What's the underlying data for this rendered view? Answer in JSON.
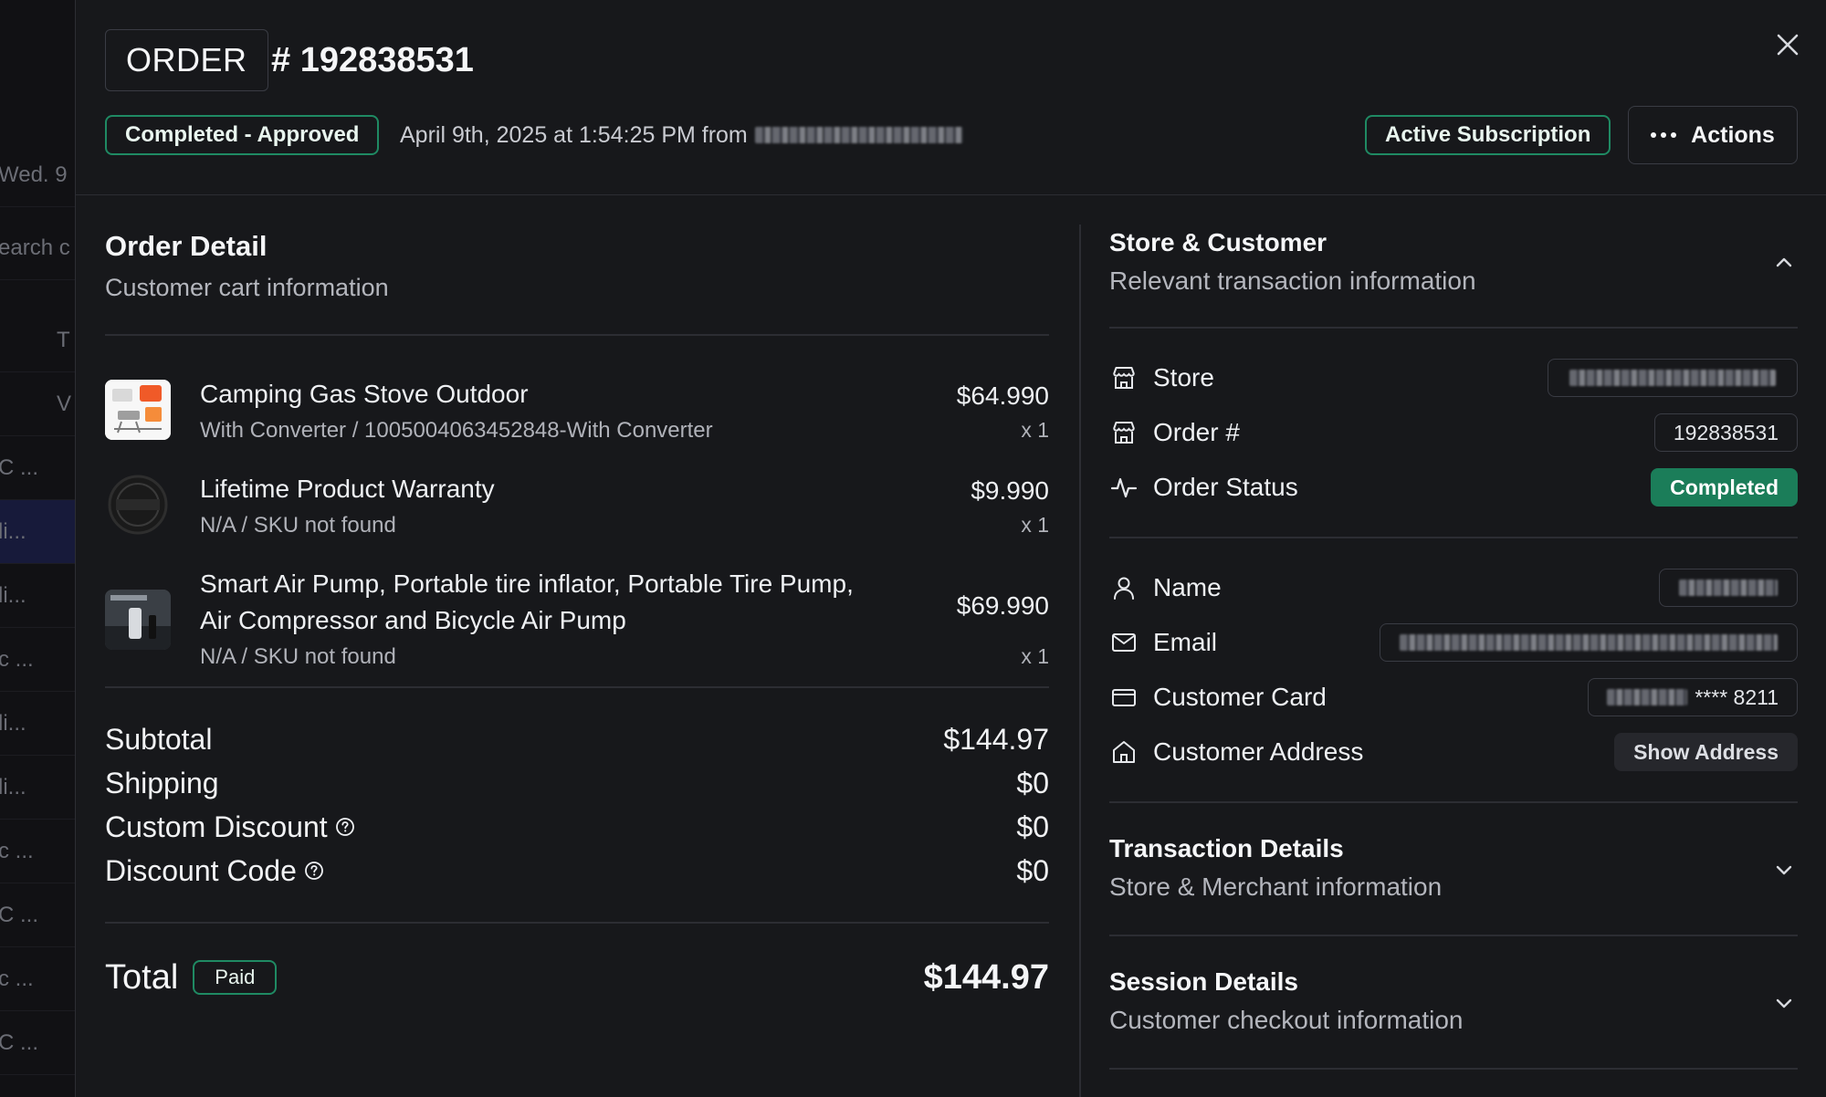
{
  "backdrop": {
    "rows": [
      "Wed. 9",
      "earch c",
      "T",
      "V",
      "C ...",
      "li...",
      "li...",
      "c ...",
      "li...",
      "li...",
      "c ...",
      "C ...",
      "c ...",
      "C ..."
    ]
  },
  "header": {
    "order_label": "ORDER",
    "order_number": "# 192838531",
    "status": "Completed - Approved",
    "timestamp": "April 9th, 2025 at 1:54:25 PM from",
    "subscription": "Active Subscription",
    "actions_label": "Actions"
  },
  "order_detail": {
    "title": "Order Detail",
    "subtitle": "Customer cart information",
    "items": [
      {
        "title": "Camping Gas Stove Outdoor",
        "subtitle": "With Converter / 1005004063452848-With Converter",
        "price": "$64.990",
        "qty": "x 1"
      },
      {
        "title": "Lifetime Product Warranty",
        "subtitle": "N/A / SKU not found",
        "price": "$9.990",
        "qty": "x 1"
      },
      {
        "title_line1": "Smart Air Pump, Portable tire inflator, Portable Tire Pump,",
        "title_line2": "Air Compressor and Bicycle Air Pump",
        "subtitle": "N/A / SKU not found",
        "price": "$69.990",
        "qty": "x 1"
      }
    ],
    "totals": [
      {
        "label": "Subtotal",
        "value": "$144.97"
      },
      {
        "label": "Shipping",
        "value": "$0"
      },
      {
        "label": "Custom Discount",
        "value": "$0"
      },
      {
        "label": "Discount Code",
        "value": "$0"
      }
    ],
    "total_label": "Total",
    "paid_label": "Paid",
    "total_value": "$144.97"
  },
  "store_customer": {
    "title": "Store & Customer",
    "subtitle": "Relevant transaction information",
    "rows": {
      "store": {
        "label": "Store"
      },
      "order": {
        "label": "Order #",
        "value": "192838531"
      },
      "status": {
        "label": "Order Status",
        "value": "Completed"
      },
      "name": {
        "label": "Name"
      },
      "email": {
        "label": "Email"
      },
      "card": {
        "label": "Customer Card",
        "value": "**** 8211"
      },
      "address": {
        "label": "Customer Address",
        "value": "Show Address"
      }
    }
  },
  "transaction": {
    "title": "Transaction Details",
    "subtitle": "Store & Merchant information"
  },
  "session": {
    "title": "Session Details",
    "subtitle": "Customer checkout information"
  },
  "colors": {
    "accent_green": "#1b7d59",
    "badge_border": "#1f8a63",
    "background": "#17181b"
  }
}
